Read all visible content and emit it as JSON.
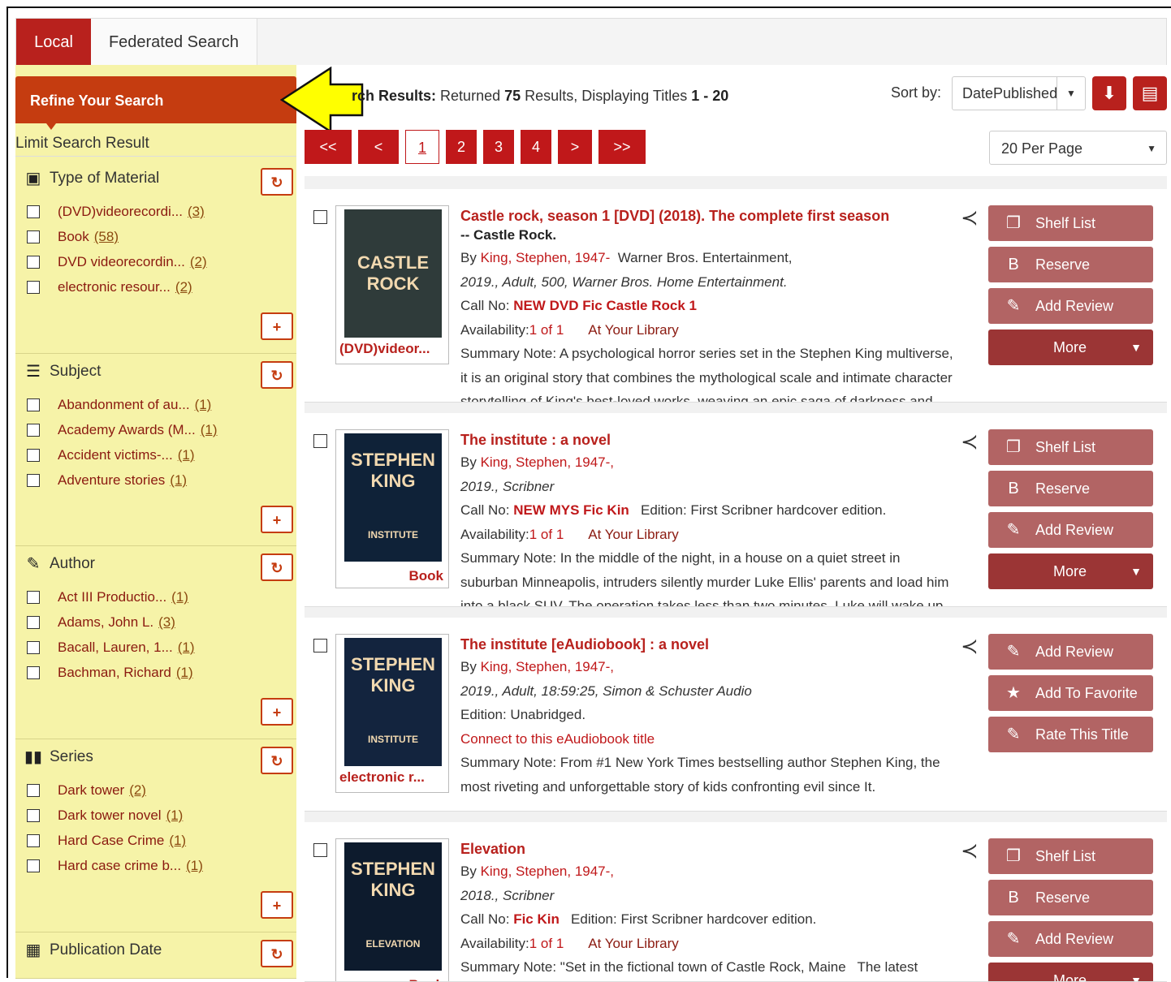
{
  "tabs": {
    "local": "Local",
    "federated": "Federated Search"
  },
  "sidebar": {
    "refine": "Refine Your Search",
    "limit": "Limit Search Result",
    "facets": [
      {
        "title": "Type of Material",
        "icon": "box-icon",
        "items": [
          {
            "label": "(DVD)videorecordi...",
            "count": "(3)"
          },
          {
            "label": "Book",
            "count": "(58)"
          },
          {
            "label": "DVD videorecordin...",
            "count": "(2)"
          },
          {
            "label": "electronic resour...",
            "count": "(2)"
          }
        ]
      },
      {
        "title": "Subject",
        "icon": "list-icon",
        "items": [
          {
            "label": "Abandonment of au...",
            "count": "(1)"
          },
          {
            "label": "Academy Awards (M...",
            "count": "(1)"
          },
          {
            "label": "Accident victims-...",
            "count": "(1)"
          },
          {
            "label": "Adventure stories",
            "count": "(1)"
          }
        ]
      },
      {
        "title": "Author",
        "icon": "pen-icon",
        "items": [
          {
            "label": "Act III Productio...",
            "count": "(1)"
          },
          {
            "label": "Adams, John L.",
            "count": "(3)"
          },
          {
            "label": "Bacall, Lauren, 1...",
            "count": "(1)"
          },
          {
            "label": "Bachman, Richard",
            "count": "(1)"
          }
        ]
      },
      {
        "title": "Series",
        "icon": "books-icon",
        "items": [
          {
            "label": "Dark tower",
            "count": "(2)"
          },
          {
            "label": "Dark tower novel",
            "count": "(1)"
          },
          {
            "label": "Hard Case Crime",
            "count": "(1)"
          },
          {
            "label": "Hard case crime b...",
            "count": "(1)"
          }
        ]
      },
      {
        "title": "Publication Date",
        "icon": "calendar-icon",
        "items": []
      }
    ],
    "reset_glyph": "↻",
    "plus_glyph": "+"
  },
  "main": {
    "summary_label": "rch Results:",
    "summary_returned": "Returned",
    "summary_count": "75",
    "summary_results": "Results, Displaying Titles",
    "summary_range": "1 - 20",
    "sort_label": "Sort by:",
    "sort_value": "DatePublished",
    "per_page": "20 Per Page",
    "pager": [
      "<<",
      "<",
      "1",
      "2",
      "3",
      "4",
      ">",
      ">>"
    ],
    "current_page": "1"
  },
  "records": [
    {
      "title": "Castle rock, season 1 [DVD] (2018). The complete first season",
      "subtitle": "-- Castle Rock.",
      "format": "(DVD)videor...",
      "cover_text": "CASTLE ROCK",
      "lines": [
        {
          "label": "By ",
          "link": "King, Stephen, 1947-",
          "rest": "  Warner Bros. Entertainment,"
        },
        {
          "italic": "2019., Adult, 500, Warner Bros. Home Entertainment."
        },
        {
          "label": "Call No: ",
          "bold": "NEW DVD Fic Castle Rock 1"
        },
        {
          "label": "Availability:",
          "link": "1 of 1",
          "rest2": "At Your Library"
        },
        {
          "text": "Summary Note: A psychological horror series set in the Stephen King multiverse,"
        },
        {
          "text": "it is an original story that combines the mythological scale and intimate character"
        },
        {
          "text": "storytelling of King's best-loved works, weaving an epic saga of darkness and"
        }
      ],
      "actions": [
        "Shelf List",
        "Reserve",
        "Add Review",
        "More"
      ]
    },
    {
      "title": "The institute : a novel",
      "format": "Book",
      "cover_text": "STEPHEN KING",
      "cover_sub": "INSTITUTE",
      "lines": [
        {
          "label": "By ",
          "link": "King, Stephen, 1947-,"
        },
        {
          "italic": "2019., Scribner"
        },
        {
          "label": "Call No: ",
          "bold": "NEW MYS Fic Kin",
          "rest": "   Edition: First Scribner hardcover edition."
        },
        {
          "label": "Availability:",
          "link": "1 of 1",
          "rest2": "At Your Library"
        },
        {
          "text": "Summary Note: In the middle of the night, in a house on a quiet street in"
        },
        {
          "text": "suburban Minneapolis, intruders silently murder Luke Ellis' parents and load him"
        },
        {
          "text": "into a black SUV. The operation takes less than two minutes. Luke will wake up"
        }
      ],
      "actions": [
        "Shelf List",
        "Reserve",
        "Add Review",
        "More"
      ]
    },
    {
      "title": "The institute [eAudiobook] : a novel",
      "format": "electronic r...",
      "cover_text": "STEPHEN KING",
      "cover_sub": "INSTITUTE",
      "lines": [
        {
          "label": "By ",
          "link": "King, Stephen, 1947-,"
        },
        {
          "italic": "2019., Adult, 18:59:25, Simon & Schuster Audio"
        },
        {
          "text": "Edition: Unabridged."
        },
        {
          "redtext": "Connect to this eAudiobook title"
        },
        {
          "text": "Summary Note: From #1 New York Times bestselling author Stephen King, the"
        },
        {
          "text": "most riveting and unforgettable story of kids confronting evil since It."
        }
      ],
      "actions": [
        "Add Review",
        "Add To Favorite",
        "Rate This Title"
      ]
    },
    {
      "title": "Elevation",
      "format": "Book",
      "cover_text": "STEPHEN KING",
      "cover_sub": "ELEVATION",
      "lines": [
        {
          "label": "By ",
          "link": "King, Stephen, 1947-,"
        },
        {
          "italic": "2018., Scribner"
        },
        {
          "label": "Call No: ",
          "bold": "Fic Kin",
          "rest": "   Edition: First Scribner hardcover edition."
        },
        {
          "label": "Availability:",
          "link": "1 of 1",
          "rest2": "At Your Library"
        },
        {
          "text": "Summary Note: \"Set in the fictional town of Castle Rock, Maine   The latest"
        }
      ],
      "actions": [
        "Shelf List",
        "Reserve",
        "Add Review",
        "More"
      ]
    }
  ],
  "colors": {
    "accent": "#b8211d",
    "sidebar": "#f6f3a8",
    "refine": "#c53c10",
    "action": "#b26464",
    "arrow": "#ffff00"
  }
}
